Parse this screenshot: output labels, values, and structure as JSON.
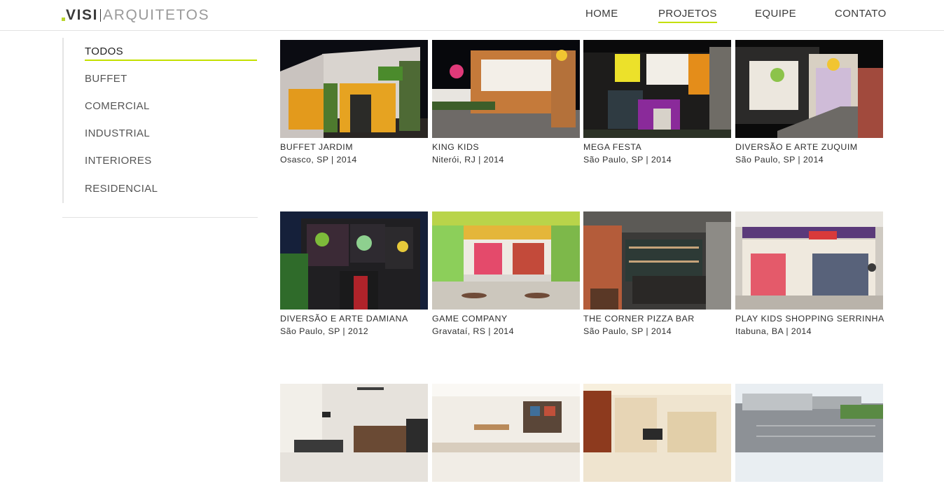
{
  "header": {
    "logo": {
      "part1": "VISI",
      "part2": "ARQUITETOS"
    },
    "nav": [
      {
        "label": "HOME"
      },
      {
        "label": "PROJETOS",
        "active": true
      },
      {
        "label": "EQUIPE"
      },
      {
        "label": "CONTATO"
      }
    ]
  },
  "sidebar": {
    "categories": [
      {
        "label": "TODOS",
        "active": true
      },
      {
        "label": "BUFFET"
      },
      {
        "label": "COMERCIAL"
      },
      {
        "label": "INDUSTRIAL"
      },
      {
        "label": "INTERIORES"
      },
      {
        "label": "RESIDENCIAL"
      }
    ]
  },
  "projects": [
    {
      "title": "BUFFET JARDIM",
      "location": "Osasco, SP | 2014"
    },
    {
      "title": "KING KIDS",
      "location": "Niterói, RJ | 2014"
    },
    {
      "title": "MEGA FESTA",
      "location": "São Paulo, SP | 2014"
    },
    {
      "title": "DIVERSÃO E ARTE ZUQUIM",
      "location": "São Paulo, SP | 2014"
    },
    {
      "title": "DIVERSÃO E ARTE DAMIANA",
      "location": "São Paulo, SP | 2012"
    },
    {
      "title": "GAME COMPANY",
      "location": "Gravataí, RS | 2014"
    },
    {
      "title": "THE CORNER PIZZA BAR",
      "location": "São Paulo, SP | 2014"
    },
    {
      "title": "PLAY KIDS SHOPPING SERRINHA",
      "location": "Itabuna, BA | 2014"
    },
    {
      "title": "",
      "location": ""
    },
    {
      "title": "",
      "location": ""
    },
    {
      "title": "",
      "location": ""
    },
    {
      "title": "",
      "location": ""
    }
  ],
  "colors": {
    "accent": "#c4e000",
    "text": "#3a3a3a",
    "divider": "#e2e2e2"
  }
}
